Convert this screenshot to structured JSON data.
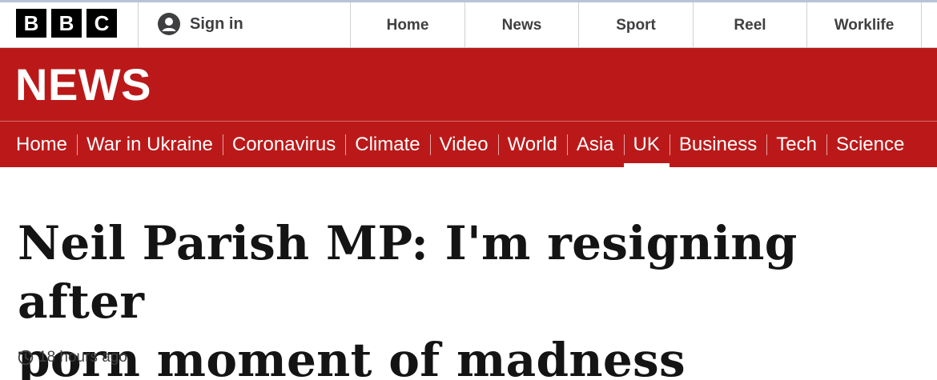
{
  "global_header": {
    "logo": [
      "B",
      "B",
      "C"
    ],
    "sign_in_label": "Sign in",
    "nav": [
      "Home",
      "News",
      "Sport",
      "Reel",
      "Worklife"
    ]
  },
  "masthead": {
    "title": "NEWS",
    "sections": [
      {
        "label": "Home",
        "active": false
      },
      {
        "label": "War in Ukraine",
        "active": false
      },
      {
        "label": "Coronavirus",
        "active": false
      },
      {
        "label": "Climate",
        "active": false
      },
      {
        "label": "Video",
        "active": false
      },
      {
        "label": "World",
        "active": false
      },
      {
        "label": "Asia",
        "active": false
      },
      {
        "label": "UK",
        "active": true
      },
      {
        "label": "Business",
        "active": false
      },
      {
        "label": "Tech",
        "active": false
      },
      {
        "label": "Science",
        "active": false
      }
    ]
  },
  "article": {
    "headline_line1": "Neil Parish MP: I'm resigning after",
    "headline_line2": "porn moment of madness",
    "timestamp": "18 hours ago"
  },
  "colors": {
    "brand_red": "#bb1919",
    "text_dark": "#141414",
    "text_grey": "#3f3f42"
  },
  "icons": {
    "sign_in": "user-avatar-icon",
    "timestamp": "clock-icon"
  }
}
